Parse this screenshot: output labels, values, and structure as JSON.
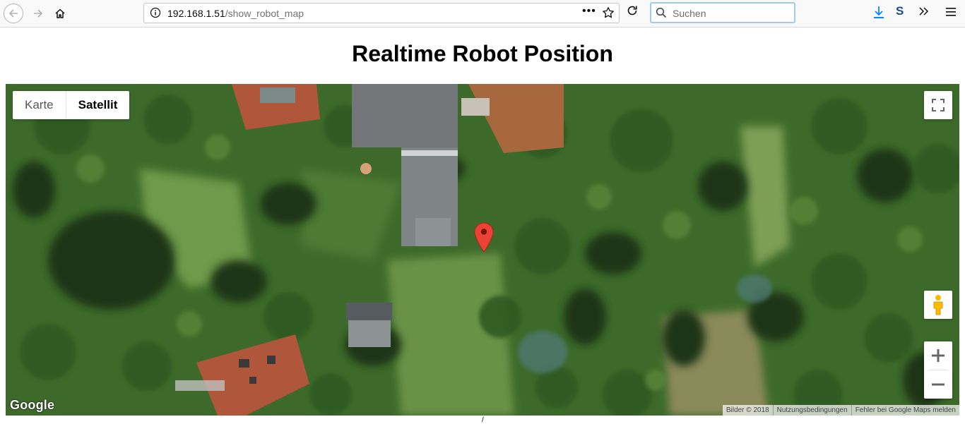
{
  "browser": {
    "url_host": "192.168.1.51",
    "url_path": "/show_robot_map",
    "url_more": "•••",
    "search_placeholder": "Suchen",
    "sync_icon_text": "S"
  },
  "page": {
    "title": "Realtime Robot Position"
  },
  "map": {
    "type_buttons": [
      "Karte",
      "Satellit"
    ],
    "active_type": "Satellit",
    "google_logo": "Google",
    "attribution": {
      "imagery": "Bilder © 2018",
      "terms": "Nutzungsbedingungen",
      "report": "Fehler bei Google Maps melden"
    },
    "marker_color": "#ea4335"
  },
  "stray_text": "/"
}
